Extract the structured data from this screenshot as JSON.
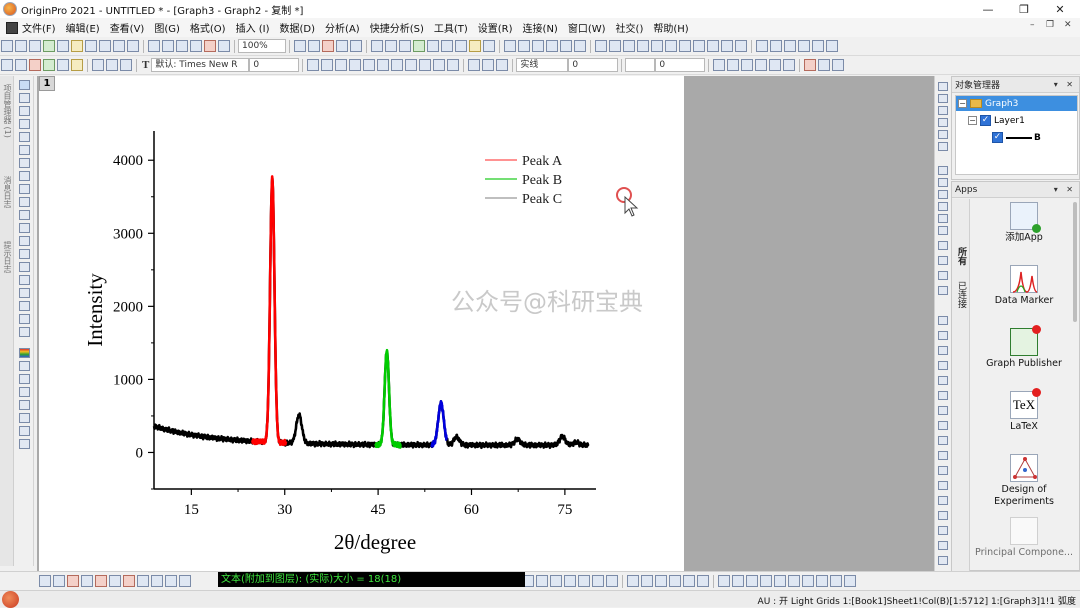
{
  "window": {
    "title": "OriginPro 2021 - UNTITLED * - [Graph3 - Graph2 - 复制 *]",
    "controls": [
      "—",
      "❐",
      "✕"
    ]
  },
  "menu": {
    "items": [
      "文件(F)",
      "编辑(E)",
      "查看(V)",
      "图(G)",
      "格式(O)",
      "插入 (I)",
      "数据(D)",
      "分析(A)",
      "快捷分析(S)",
      "工具(T)",
      "设置(R)",
      "连接(N)",
      "窗口(W)",
      "社交()",
      "帮助(H)"
    ],
    "mdi_controls": [
      "–",
      "❐",
      "✕"
    ]
  },
  "toolbar": {
    "zoom": "100%",
    "font_name": "默认: Times New R",
    "font_size": "0",
    "line_style": "实线",
    "line_width": "0",
    "fill_value": "0"
  },
  "left_strip": {
    "tabs": [
      "项目管理器 (1)",
      "消息日志",
      "提示日志"
    ]
  },
  "graph": {
    "layer_number": "1",
    "watermark": "公众号@科研宝典",
    "legend": [
      "Peak A",
      "Peak B",
      "Peak C"
    ]
  },
  "chart_data": {
    "type": "line",
    "xlabel": "2θ/degree",
    "ylabel": "Intensity",
    "xlim": [
      9,
      80
    ],
    "ylim": [
      -500,
      4400
    ],
    "xticks": [
      15,
      30,
      45,
      60,
      75
    ],
    "yticks": [
      0,
      1000,
      2000,
      3000,
      4000
    ],
    "legend_position": "top-right",
    "series": [
      {
        "name": "Peak A",
        "color": "#ff0000",
        "x_range": [
          24.8,
          30.2
        ]
      },
      {
        "name": "Peak B",
        "color": "#00cc00",
        "x_range": [
          44.6,
          48.6
        ]
      },
      {
        "name": "Peak C",
        "color": "#0000dd",
        "x_range": [
          53.6,
          56.0
        ]
      }
    ],
    "baseline_color": "#000000",
    "peaks": [
      {
        "x": 28.0,
        "y": 3730
      },
      {
        "x": 32.3,
        "y": 510
      },
      {
        "x": 46.4,
        "y": 1400
      },
      {
        "x": 55.1,
        "y": 690
      },
      {
        "x": 57.6,
        "y": 230
      },
      {
        "x": 67.4,
        "y": 200
      },
      {
        "x": 74.6,
        "y": 240
      },
      {
        "x": 76.8,
        "y": 160
      }
    ]
  },
  "object_manager": {
    "title": "对象管理器",
    "header_buttons": "▾ ✕",
    "graph": "Graph3",
    "layer": "Layer1",
    "plot": "B"
  },
  "apps": {
    "title": "Apps",
    "header_buttons": "▾ ✕",
    "side_tabs": [
      "所有",
      "已连接"
    ],
    "items": [
      "添加App",
      "Data Marker",
      "Graph Publisher",
      "LaTeX",
      "Design of Experiments",
      "Principal Compone..."
    ]
  },
  "bottom": {
    "hint": "文本(附加到图层): (实际)大小 = 18(18)"
  },
  "status": {
    "text": "AU : 开  Light Grids  1:[Book1]Sheet1!Col(B)[1:5712]  1:[Graph3]1!1  弧度"
  }
}
